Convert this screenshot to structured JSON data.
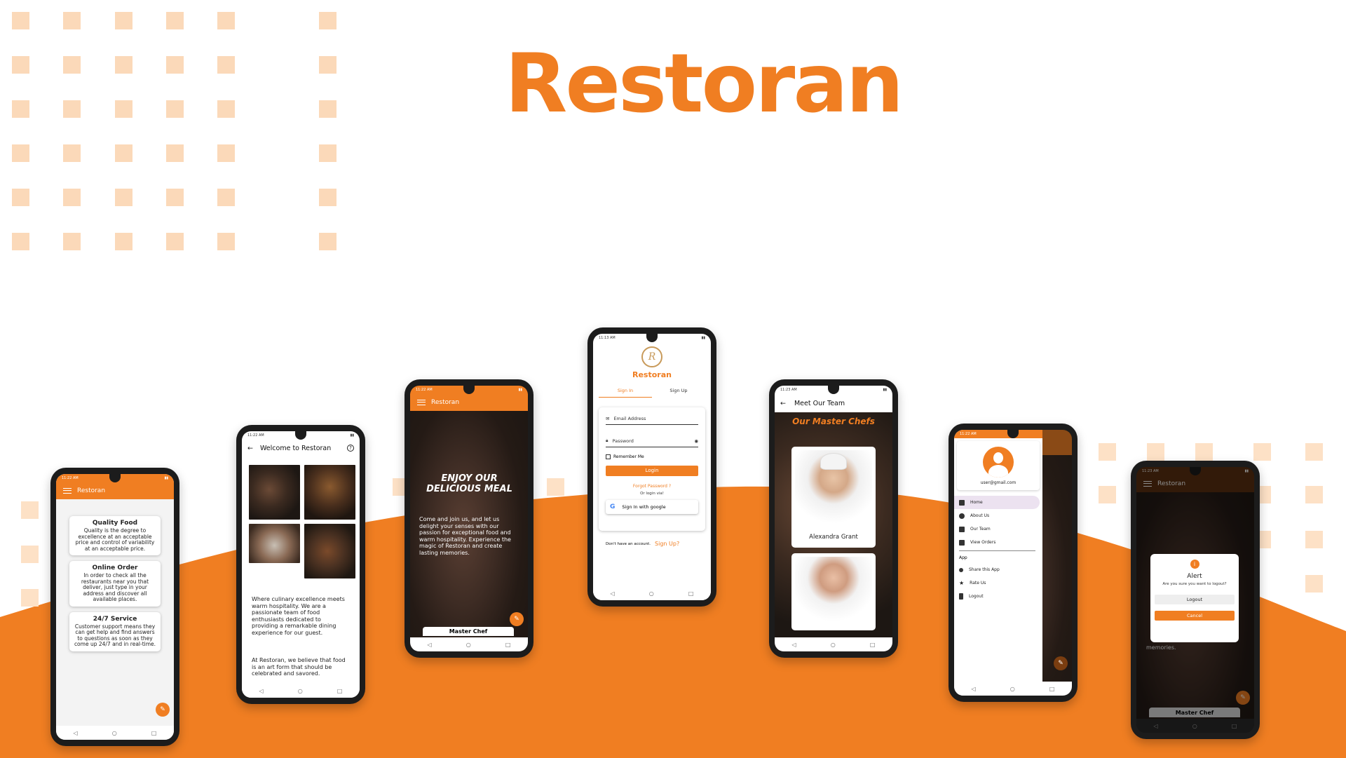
{
  "brand": {
    "title": "Restoran",
    "accent": "#f07e22"
  },
  "phones": {
    "services": {
      "status_time": "11:22 AM",
      "appbar_title": "Restoran",
      "cards": [
        {
          "title": "Quality Food",
          "text": "Quality is the degree to excellence at an acceptable price and control of variability at an acceptable price."
        },
        {
          "title": "Online Order",
          "text": "In order to check all the restaurants near you that deliver, just type in your address and discover all available places."
        },
        {
          "title": "24/7 Service",
          "text": "Customer support means they can get help and find answers to questions as soon as they come up 24/7 and in real-time."
        }
      ],
      "nav": {
        "back": "◁",
        "home": "○",
        "recent": "□"
      }
    },
    "welcome": {
      "status_time": "11:22 AM",
      "title": "Welcome to Restoran",
      "back_icon": "←",
      "help_icon": "?",
      "paragraph1": "Where culinary excellence meets warm hospitality. We are a passionate team of food enthusiasts dedicated to providing a remarkable dining experience for our guest.",
      "paragraph2": "At Restoran, we believe that food is an art form that should be celebrated and savored."
    },
    "home": {
      "status_time": "11:22 AM",
      "appbar_title": "Restoran",
      "headline": "ENJOY OUR DELICIOUS MEAL",
      "body": "Come and join us, and let us delight your senses with our passion for exceptional food and warm hospitality. Experience the magic of Restoran and create lasting memories.",
      "bottom_card": "Master Chef"
    },
    "login": {
      "status_time": "11:13 AM",
      "logo_letter": "R",
      "brand": "Restoran",
      "tab_signin": "Sign In",
      "tab_signup": "Sign Up",
      "email_placeholder": "Email Address",
      "password_placeholder": "Password",
      "remember": "Remember Me",
      "login_button": "Login",
      "forgot": "Forgot Password ?",
      "or_login": "Or login via!",
      "google": "Sign In with google",
      "no_account": "Don't have an account.",
      "signup_link": "Sign Up?"
    },
    "team": {
      "status_time": "11:23 AM",
      "title": "Meet Our Team",
      "heading": "Our Master Chefs",
      "chef1": "Alexandra Grant"
    },
    "drawer": {
      "status_time": "11:22 AM",
      "email": "user@gmail.com",
      "items": [
        {
          "label": "Home",
          "icon": "home-icon"
        },
        {
          "label": "About Us",
          "icon": "info-icon"
        },
        {
          "label": "Our Team",
          "icon": "team-icon"
        },
        {
          "label": "View Orders",
          "icon": "orders-icon"
        }
      ],
      "section_app": "App",
      "app_items": [
        {
          "label": "Share this App",
          "icon": "share-icon"
        },
        {
          "label": "Rate Us",
          "icon": "star-icon"
        },
        {
          "label": "Logout",
          "icon": "logout-icon"
        }
      ]
    },
    "logout": {
      "status_time": "11:23 AM",
      "appbar_title": "Restoran",
      "alert_title": "Alert",
      "alert_text": "Are you sure you want to logout?",
      "logout_button": "Logout",
      "cancel_button": "Cancel",
      "bg_text": "memories.",
      "bottom_card": "Master Chef"
    }
  }
}
